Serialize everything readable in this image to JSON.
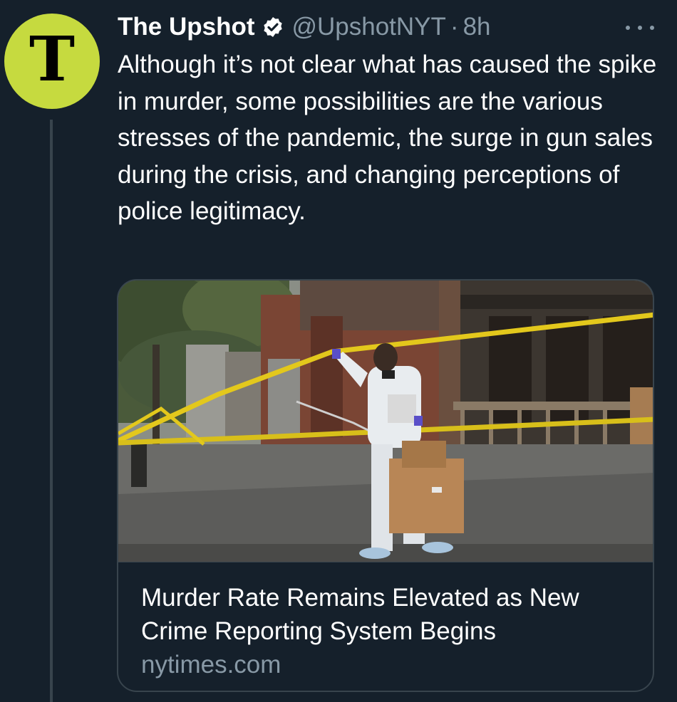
{
  "tweet": {
    "display_name": "The Upshot",
    "handle": "@UpshotNYT",
    "separator": "·",
    "time": "8h",
    "avatar_letter": "T",
    "text": "Although it’s not clear what has caused the spike in murder, some possibilities are the various stresses of the pandemic, the surge in gun sales during the crisis, and changing perceptions of police legitimacy."
  },
  "card": {
    "title": "Murder Rate Remains Elevated as New Crime Reporting System Begins",
    "domain": "nytimes.com"
  },
  "icons": {
    "verified": "verified-badge-icon",
    "more": "more-options-icon"
  },
  "colors": {
    "background": "#15202b",
    "avatar_bg": "#c6da3f",
    "secondary_text": "#8899a6",
    "border": "#38444d",
    "caution_tape": "#e3c81c"
  }
}
